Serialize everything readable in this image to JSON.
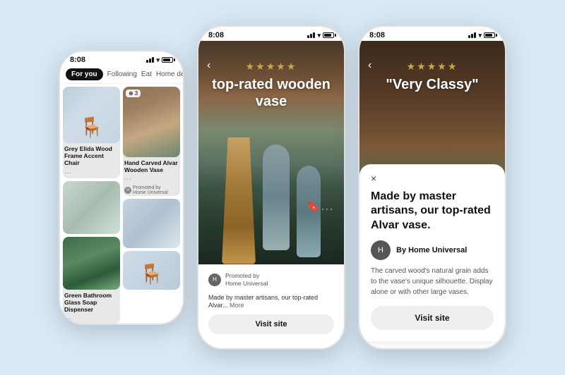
{
  "phone1": {
    "statusBar": {
      "time": "8:08"
    },
    "tabs": [
      "For you",
      "Following",
      "Eat",
      "Home decor"
    ],
    "cards": [
      {
        "col": 1,
        "items": [
          {
            "id": "chair",
            "label": "Grey Elida Wood Frame Accent Chair",
            "type": "chair"
          },
          {
            "id": "sink",
            "label": "",
            "type": "sink"
          },
          {
            "id": "soap",
            "label": "Green Bathroom Glass Soap Dispenser",
            "type": "soap"
          }
        ]
      },
      {
        "col": 2,
        "items": [
          {
            "id": "vase",
            "label": "Hand Carved Alvar Wooden Vase",
            "badge": "3",
            "promoted": true,
            "promotedBy": "Home Universal",
            "type": "vase"
          },
          {
            "id": "bottles",
            "label": "",
            "type": "bottles"
          },
          {
            "id": "bath",
            "label": "",
            "type": "bath"
          }
        ]
      }
    ],
    "moreDotsLabel": "..."
  },
  "phone2": {
    "statusBar": {
      "time": "8:08"
    },
    "stars": "★★★★★",
    "title": "top-rated wooden vase",
    "backLabel": "‹",
    "promotedBy": "Promoted by",
    "brand": "Home Universal",
    "caption": "Made by master artisans, our top-rated Alvar...",
    "moreLabel": "More",
    "visitLabel": "Visit site",
    "saveIcon": "🔖",
    "dotsLabel": "···",
    "avatarText": "H"
  },
  "phone3": {
    "statusBar": {
      "time": "8:08"
    },
    "stars": "★★★★★",
    "title": "\"Very Classy\"",
    "backLabel": "‹",
    "popup": {
      "closeLabel": "×",
      "title": "Made by master artisans, our top-rated Alvar vase.",
      "byLabel": "By Home Universal",
      "avatarText": "H",
      "description": "The carved wood's natural grain adds to the vase's unique silhouette. Display alone or with other large vases.",
      "visitLabel": "Visit site"
    }
  }
}
